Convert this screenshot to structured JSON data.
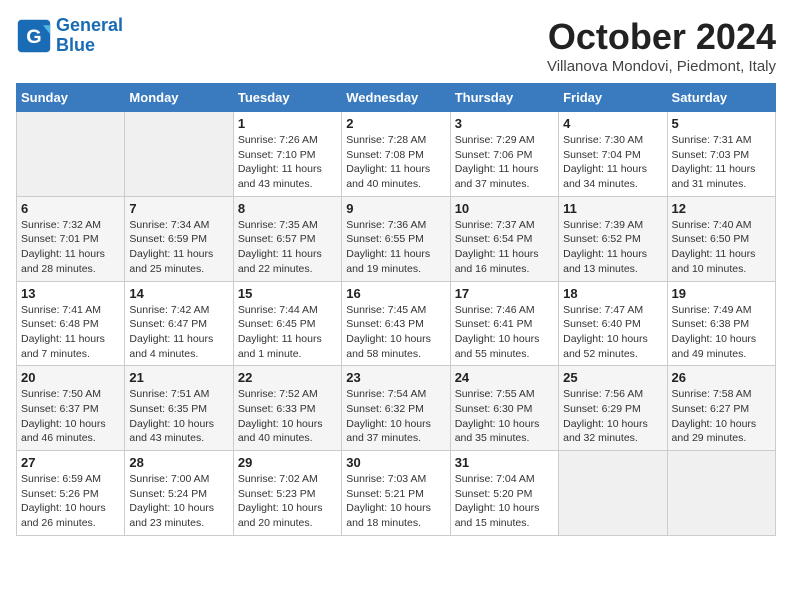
{
  "header": {
    "logo_line1": "General",
    "logo_line2": "Blue",
    "month": "October 2024",
    "location": "Villanova Mondovi, Piedmont, Italy"
  },
  "weekdays": [
    "Sunday",
    "Monday",
    "Tuesday",
    "Wednesday",
    "Thursday",
    "Friday",
    "Saturday"
  ],
  "weeks": [
    [
      {
        "day": "",
        "sunrise": "",
        "sunset": "",
        "daylight": ""
      },
      {
        "day": "",
        "sunrise": "",
        "sunset": "",
        "daylight": ""
      },
      {
        "day": "1",
        "sunrise": "Sunrise: 7:26 AM",
        "sunset": "Sunset: 7:10 PM",
        "daylight": "Daylight: 11 hours and 43 minutes."
      },
      {
        "day": "2",
        "sunrise": "Sunrise: 7:28 AM",
        "sunset": "Sunset: 7:08 PM",
        "daylight": "Daylight: 11 hours and 40 minutes."
      },
      {
        "day": "3",
        "sunrise": "Sunrise: 7:29 AM",
        "sunset": "Sunset: 7:06 PM",
        "daylight": "Daylight: 11 hours and 37 minutes."
      },
      {
        "day": "4",
        "sunrise": "Sunrise: 7:30 AM",
        "sunset": "Sunset: 7:04 PM",
        "daylight": "Daylight: 11 hours and 34 minutes."
      },
      {
        "day": "5",
        "sunrise": "Sunrise: 7:31 AM",
        "sunset": "Sunset: 7:03 PM",
        "daylight": "Daylight: 11 hours and 31 minutes."
      }
    ],
    [
      {
        "day": "6",
        "sunrise": "Sunrise: 7:32 AM",
        "sunset": "Sunset: 7:01 PM",
        "daylight": "Daylight: 11 hours and 28 minutes."
      },
      {
        "day": "7",
        "sunrise": "Sunrise: 7:34 AM",
        "sunset": "Sunset: 6:59 PM",
        "daylight": "Daylight: 11 hours and 25 minutes."
      },
      {
        "day": "8",
        "sunrise": "Sunrise: 7:35 AM",
        "sunset": "Sunset: 6:57 PM",
        "daylight": "Daylight: 11 hours and 22 minutes."
      },
      {
        "day": "9",
        "sunrise": "Sunrise: 7:36 AM",
        "sunset": "Sunset: 6:55 PM",
        "daylight": "Daylight: 11 hours and 19 minutes."
      },
      {
        "day": "10",
        "sunrise": "Sunrise: 7:37 AM",
        "sunset": "Sunset: 6:54 PM",
        "daylight": "Daylight: 11 hours and 16 minutes."
      },
      {
        "day": "11",
        "sunrise": "Sunrise: 7:39 AM",
        "sunset": "Sunset: 6:52 PM",
        "daylight": "Daylight: 11 hours and 13 minutes."
      },
      {
        "day": "12",
        "sunrise": "Sunrise: 7:40 AM",
        "sunset": "Sunset: 6:50 PM",
        "daylight": "Daylight: 11 hours and 10 minutes."
      }
    ],
    [
      {
        "day": "13",
        "sunrise": "Sunrise: 7:41 AM",
        "sunset": "Sunset: 6:48 PM",
        "daylight": "Daylight: 11 hours and 7 minutes."
      },
      {
        "day": "14",
        "sunrise": "Sunrise: 7:42 AM",
        "sunset": "Sunset: 6:47 PM",
        "daylight": "Daylight: 11 hours and 4 minutes."
      },
      {
        "day": "15",
        "sunrise": "Sunrise: 7:44 AM",
        "sunset": "Sunset: 6:45 PM",
        "daylight": "Daylight: 11 hours and 1 minute."
      },
      {
        "day": "16",
        "sunrise": "Sunrise: 7:45 AM",
        "sunset": "Sunset: 6:43 PM",
        "daylight": "Daylight: 10 hours and 58 minutes."
      },
      {
        "day": "17",
        "sunrise": "Sunrise: 7:46 AM",
        "sunset": "Sunset: 6:41 PM",
        "daylight": "Daylight: 10 hours and 55 minutes."
      },
      {
        "day": "18",
        "sunrise": "Sunrise: 7:47 AM",
        "sunset": "Sunset: 6:40 PM",
        "daylight": "Daylight: 10 hours and 52 minutes."
      },
      {
        "day": "19",
        "sunrise": "Sunrise: 7:49 AM",
        "sunset": "Sunset: 6:38 PM",
        "daylight": "Daylight: 10 hours and 49 minutes."
      }
    ],
    [
      {
        "day": "20",
        "sunrise": "Sunrise: 7:50 AM",
        "sunset": "Sunset: 6:37 PM",
        "daylight": "Daylight: 10 hours and 46 minutes."
      },
      {
        "day": "21",
        "sunrise": "Sunrise: 7:51 AM",
        "sunset": "Sunset: 6:35 PM",
        "daylight": "Daylight: 10 hours and 43 minutes."
      },
      {
        "day": "22",
        "sunrise": "Sunrise: 7:52 AM",
        "sunset": "Sunset: 6:33 PM",
        "daylight": "Daylight: 10 hours and 40 minutes."
      },
      {
        "day": "23",
        "sunrise": "Sunrise: 7:54 AM",
        "sunset": "Sunset: 6:32 PM",
        "daylight": "Daylight: 10 hours and 37 minutes."
      },
      {
        "day": "24",
        "sunrise": "Sunrise: 7:55 AM",
        "sunset": "Sunset: 6:30 PM",
        "daylight": "Daylight: 10 hours and 35 minutes."
      },
      {
        "day": "25",
        "sunrise": "Sunrise: 7:56 AM",
        "sunset": "Sunset: 6:29 PM",
        "daylight": "Daylight: 10 hours and 32 minutes."
      },
      {
        "day": "26",
        "sunrise": "Sunrise: 7:58 AM",
        "sunset": "Sunset: 6:27 PM",
        "daylight": "Daylight: 10 hours and 29 minutes."
      }
    ],
    [
      {
        "day": "27",
        "sunrise": "Sunrise: 6:59 AM",
        "sunset": "Sunset: 5:26 PM",
        "daylight": "Daylight: 10 hours and 26 minutes."
      },
      {
        "day": "28",
        "sunrise": "Sunrise: 7:00 AM",
        "sunset": "Sunset: 5:24 PM",
        "daylight": "Daylight: 10 hours and 23 minutes."
      },
      {
        "day": "29",
        "sunrise": "Sunrise: 7:02 AM",
        "sunset": "Sunset: 5:23 PM",
        "daylight": "Daylight: 10 hours and 20 minutes."
      },
      {
        "day": "30",
        "sunrise": "Sunrise: 7:03 AM",
        "sunset": "Sunset: 5:21 PM",
        "daylight": "Daylight: 10 hours and 18 minutes."
      },
      {
        "day": "31",
        "sunrise": "Sunrise: 7:04 AM",
        "sunset": "Sunset: 5:20 PM",
        "daylight": "Daylight: 10 hours and 15 minutes."
      },
      {
        "day": "",
        "sunrise": "",
        "sunset": "",
        "daylight": ""
      },
      {
        "day": "",
        "sunrise": "",
        "sunset": "",
        "daylight": ""
      }
    ]
  ]
}
